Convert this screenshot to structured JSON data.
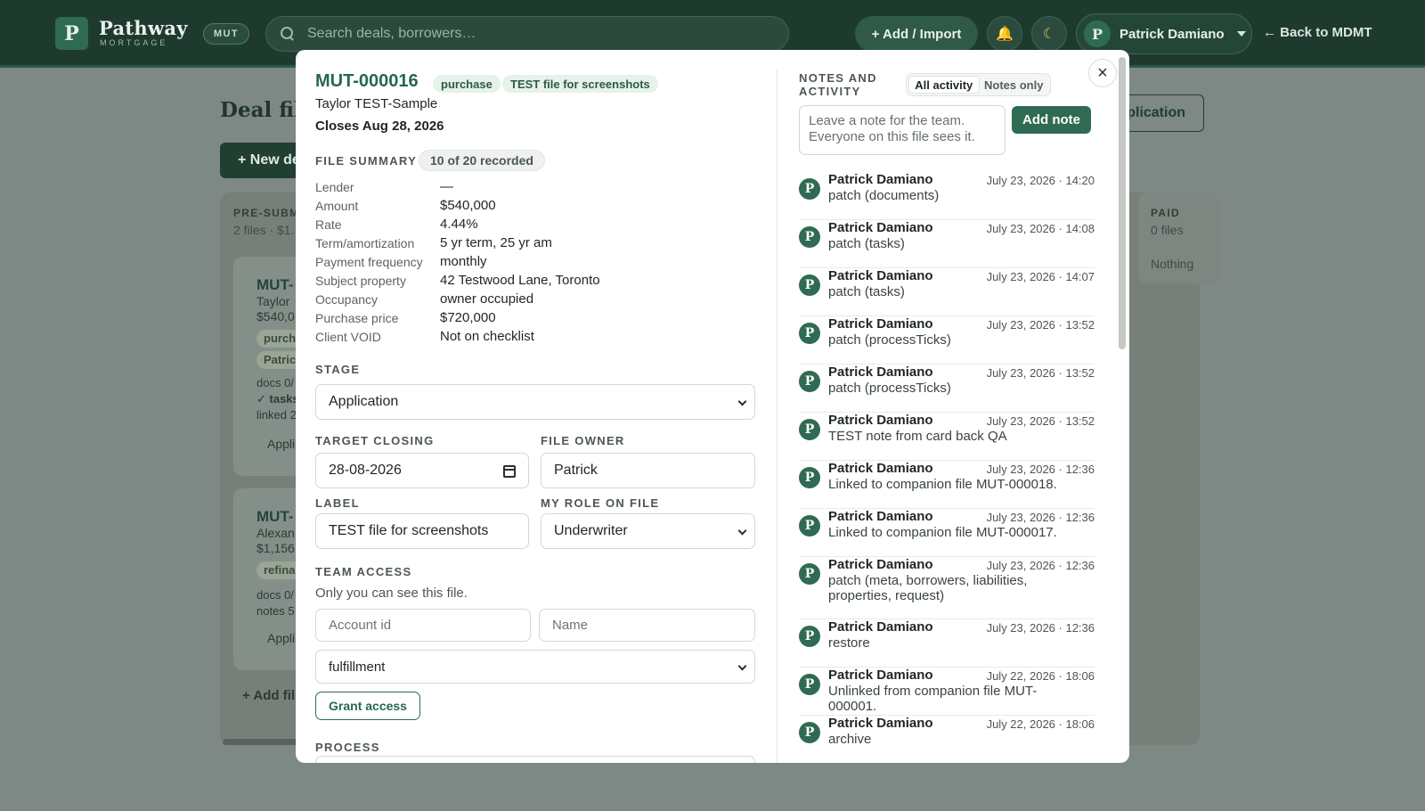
{
  "topbar": {
    "brand": {
      "name": "Pathway",
      "sub": "MORTGAGE",
      "mark": "P"
    },
    "env_badge": "MUT",
    "search": {
      "placeholder": "Search deals, borrowers…"
    },
    "add_label": "+ Add / Import",
    "user": {
      "initial": "P",
      "name": "Patrick Damiano"
    },
    "back_label": "← Back to MDMT",
    "icons": [
      "search-icon",
      "bell-icon",
      "moon-icon",
      "chevron-down-icon"
    ]
  },
  "background": {
    "page_title": "Deal file",
    "new_deal_label": "+ New de",
    "application_label": "plication",
    "columns": [
      {
        "head": "PRE-SUBM",
        "sub": "2 files · $1."
      },
      {
        "head": "PAID",
        "sub": "0 files",
        "empty": "Nothing"
      }
    ],
    "cards": [
      {
        "id": "MUT-",
        "name": "Taylor",
        "amount": "$540,0",
        "chips": [
          "purch",
          "Patric"
        ],
        "lines": [
          "docs 0/",
          "✓ tasks",
          "linked 2"
        ],
        "footer": "Appli"
      },
      {
        "id": "MUT-",
        "name": "Alexan",
        "amount": "$1,156",
        "chips": [
          "refina"
        ],
        "lines": [
          "docs 0/",
          "notes 5"
        ],
        "footer": "Appli"
      }
    ],
    "add_file_label": "+ Add fil"
  },
  "modal": {
    "file_id": "MUT-000016",
    "type_chip": "purchase",
    "label_chip": "TEST file for screenshots",
    "borrower": "Taylor TEST-Sample",
    "closes": "Closes Aug 28, 2026",
    "summary": {
      "title": "FILE SUMMARY",
      "recorded": "10 of 20 recorded",
      "rows": [
        {
          "label": "Lender",
          "value": "—"
        },
        {
          "label": "Amount",
          "value": "$540,000"
        },
        {
          "label": "Rate",
          "value": "4.44%"
        },
        {
          "label": "Term/amortization",
          "value": "5 yr term, 25 yr am"
        },
        {
          "label": "Payment frequency",
          "value": "monthly"
        },
        {
          "label": "Subject property",
          "value": "42 Testwood Lane, Toronto"
        },
        {
          "label": "Occupancy",
          "value": "owner occupied"
        },
        {
          "label": "Purchase price",
          "value": "$720,000"
        },
        {
          "label": "Client VOID",
          "value": "Not on checklist"
        }
      ]
    },
    "stage": {
      "label": "STAGE",
      "value": "Application"
    },
    "target_closing": {
      "label": "TARGET CLOSING",
      "value": "28-08-2026"
    },
    "file_owner": {
      "label": "FILE OWNER",
      "value": "Patrick"
    },
    "label_field": {
      "label": "LABEL",
      "value": "TEST file for screenshots"
    },
    "my_role": {
      "label": "MY ROLE ON FILE",
      "value": "Underwriter"
    },
    "team_access": {
      "label": "TEAM ACCESS",
      "note": "Only you can see this file.",
      "account_placeholder": "Account id",
      "name_placeholder": "Name",
      "role_value": "fulfillment",
      "grant_label": "Grant access"
    },
    "process_label": "PROCESS"
  },
  "notes": {
    "title": "NOTES AND ACTIVITY",
    "toggle_all": "All activity",
    "toggle_notes": "Notes only",
    "input_placeholder": "Leave a note for the team. Everyone on this file sees it.",
    "add_label": "Add note",
    "items": [
      {
        "who": "Patrick Damiano",
        "when": "July 23, 2026 · 14:20",
        "what": "patch (documents)"
      },
      {
        "who": "Patrick Damiano",
        "when": "July 23, 2026 · 14:08",
        "what": "patch (tasks)"
      },
      {
        "who": "Patrick Damiano",
        "when": "July 23, 2026 · 14:07",
        "what": "patch (tasks)"
      },
      {
        "who": "Patrick Damiano",
        "when": "July 23, 2026 · 13:52",
        "what": "patch (processTicks)"
      },
      {
        "who": "Patrick Damiano",
        "when": "July 23, 2026 · 13:52",
        "what": "patch (processTicks)"
      },
      {
        "who": "Patrick Damiano",
        "when": "July 23, 2026 · 13:52",
        "what": "TEST note from card back QA"
      },
      {
        "who": "Patrick Damiano",
        "when": "July 23, 2026 · 12:36",
        "what": "Linked to companion file MUT-000018."
      },
      {
        "who": "Patrick Damiano",
        "when": "July 23, 2026 · 12:36",
        "what": "Linked to companion file MUT-000017."
      },
      {
        "who": "Patrick Damiano",
        "when": "July 23, 2026 · 12:36",
        "what": "patch (meta, borrowers, liabilities, properties, request)"
      },
      {
        "who": "Patrick Damiano",
        "when": "July 23, 2026 · 12:36",
        "what": "restore"
      },
      {
        "who": "Patrick Damiano",
        "when": "July 22, 2026 · 18:06",
        "what": "Unlinked from companion file MUT-000001."
      },
      {
        "who": "Patrick Damiano",
        "when": "July 22, 2026 · 18:06",
        "what": "archive"
      }
    ],
    "avatar_initial": "P"
  },
  "close_icon": "×",
  "colors": {
    "brand_dark": "#1e3a2f",
    "brand": "#2f6b52",
    "accent_text": "#26684e",
    "overlay": "#7e8884"
  }
}
